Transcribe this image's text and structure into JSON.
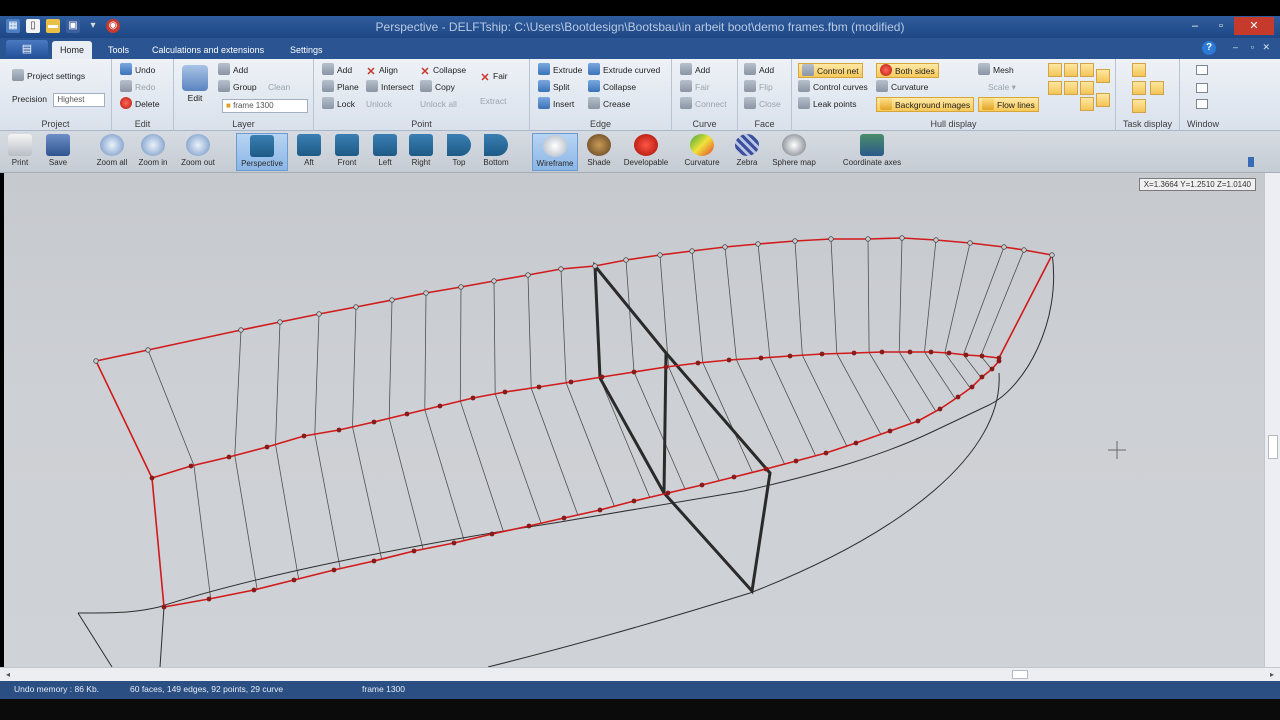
{
  "window": {
    "title": "Perspective - DELFTship: C:\\Users\\Bootdesign\\Bootsbau\\in arbeit boot\\demo frames.fbm (modified)"
  },
  "tabs": [
    {
      "label": "Home"
    },
    {
      "label": "Tools"
    },
    {
      "label": "Calculations and extensions"
    },
    {
      "label": "Settings"
    }
  ],
  "ribbon": {
    "project": {
      "label": "Project",
      "settings": "Project settings",
      "precision_label": "Precision",
      "precision_value": "Highest"
    },
    "edit": {
      "label": "Edit",
      "undo": "Undo",
      "redo": "Redo",
      "delete": "Delete"
    },
    "layer": {
      "label": "Layer",
      "edit": "Edit",
      "add": "Add",
      "group": "Group",
      "clean": "Clean",
      "active_layer": "frame 1300"
    },
    "point": {
      "label": "Point",
      "add": "Add",
      "plane": "Plane",
      "lock": "Lock",
      "align": "Align",
      "intersect": "Intersect",
      "unlock": "Unlock",
      "collapse": "Collapse",
      "copy": "Copy",
      "unlock_all": "Unlock all",
      "fair": "Fair",
      "extract": "Extract"
    },
    "edge": {
      "label": "Edge",
      "extrude": "Extrude",
      "split": "Split",
      "insert": "Insert",
      "extrude_curved": "Extrude curved",
      "collapse": "Collapse",
      "crease": "Crease"
    },
    "curve": {
      "label": "Curve",
      "add": "Add",
      "fair": "Fair",
      "connect": "Connect"
    },
    "face": {
      "label": "Face",
      "add": "Add",
      "flip": "Flip",
      "close": "Close"
    },
    "hull_display": {
      "label": "Hull display",
      "control_net": "Control net",
      "control_curves": "Control curves",
      "leak_points": "Leak points",
      "both_sides": "Both sides",
      "curvature": "Curvature",
      "background_images": "Background images",
      "mesh": "Mesh",
      "scale": "Scale",
      "flow_lines": "Flow lines"
    },
    "task_display": {
      "label": "Task display"
    },
    "window_group": {
      "label": "Window"
    }
  },
  "toolbar": [
    {
      "label": "Print",
      "icon": "print-icon"
    },
    {
      "label": "Save",
      "icon": "save-icon"
    },
    {
      "label": "Zoom all",
      "icon": "zoom-all-icon"
    },
    {
      "label": "Zoom in",
      "icon": "zoom-in-icon"
    },
    {
      "label": "Zoom out",
      "icon": "zoom-out-icon"
    },
    {
      "label": "Perspective",
      "icon": "perspective-icon",
      "selected": true
    },
    {
      "label": "Aft",
      "icon": "aft-view-icon"
    },
    {
      "label": "Front",
      "icon": "front-view-icon"
    },
    {
      "label": "Left",
      "icon": "left-view-icon"
    },
    {
      "label": "Right",
      "icon": "right-view-icon"
    },
    {
      "label": "Top",
      "icon": "top-view-icon"
    },
    {
      "label": "Bottom",
      "icon": "bottom-view-icon"
    },
    {
      "label": "Wireframe",
      "icon": "wireframe-icon",
      "selected": true
    },
    {
      "label": "Shade",
      "icon": "shade-icon"
    },
    {
      "label": "Developable",
      "icon": "developable-icon"
    },
    {
      "label": "Curvature",
      "icon": "curvature-icon"
    },
    {
      "label": "Zebra",
      "icon": "zebra-icon"
    },
    {
      "label": "Sphere map",
      "icon": "sphere-map-icon"
    },
    {
      "label": "Coordinate axes",
      "icon": "coordinate-axes-icon"
    }
  ],
  "viewport": {
    "coordinates": "X=1.3664 Y=1.2510 Z=1.0140"
  },
  "status": {
    "undo_memory": "Undo memory : 86 Kb.",
    "stats": "60 faces, 149 edges, 92 points, 29 curve",
    "layer": "frame 1300"
  },
  "colors": {
    "control_net": "#d11a1a",
    "frame": "#2a2a2a",
    "ribbon_accent": "#f7c95a",
    "title_bar": "#2f5d9e"
  }
}
